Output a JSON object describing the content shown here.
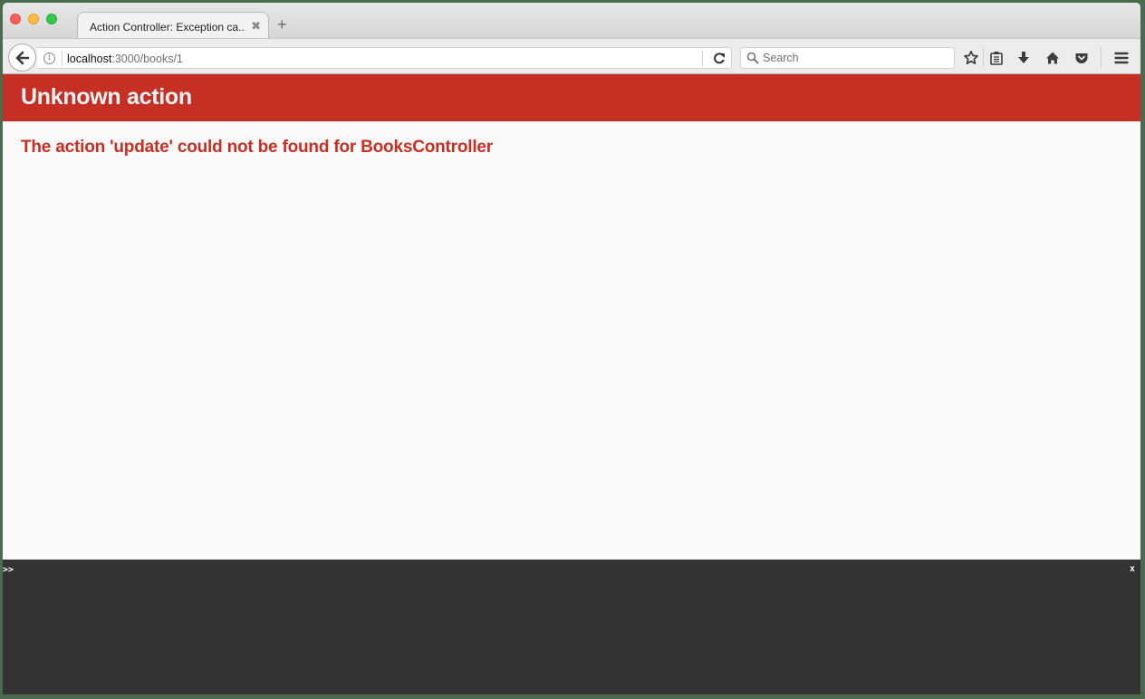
{
  "browser": {
    "tab": {
      "title": "Action Controller: Exception ca...",
      "close_glyph": "✖"
    },
    "new_tab_glyph": "+",
    "url": {
      "host": "localhost",
      "rest": ":3000/books/1"
    },
    "search": {
      "placeholder": "Search",
      "value": ""
    },
    "info_glyph": "i",
    "toolbar_icons": [
      "bookmark-star-icon",
      "reading-list-icon",
      "download-icon",
      "home-icon",
      "pocket-icon",
      "menu-icon"
    ]
  },
  "page": {
    "header": {
      "title": "Unknown action"
    },
    "message": "The action 'update' could not be found for BooksController",
    "colors": {
      "accent": "#c52f24",
      "background": "#f9f9f9"
    }
  },
  "console": {
    "prompt": ">>",
    "input_value": "",
    "close_label": "x",
    "background": "#333333"
  }
}
